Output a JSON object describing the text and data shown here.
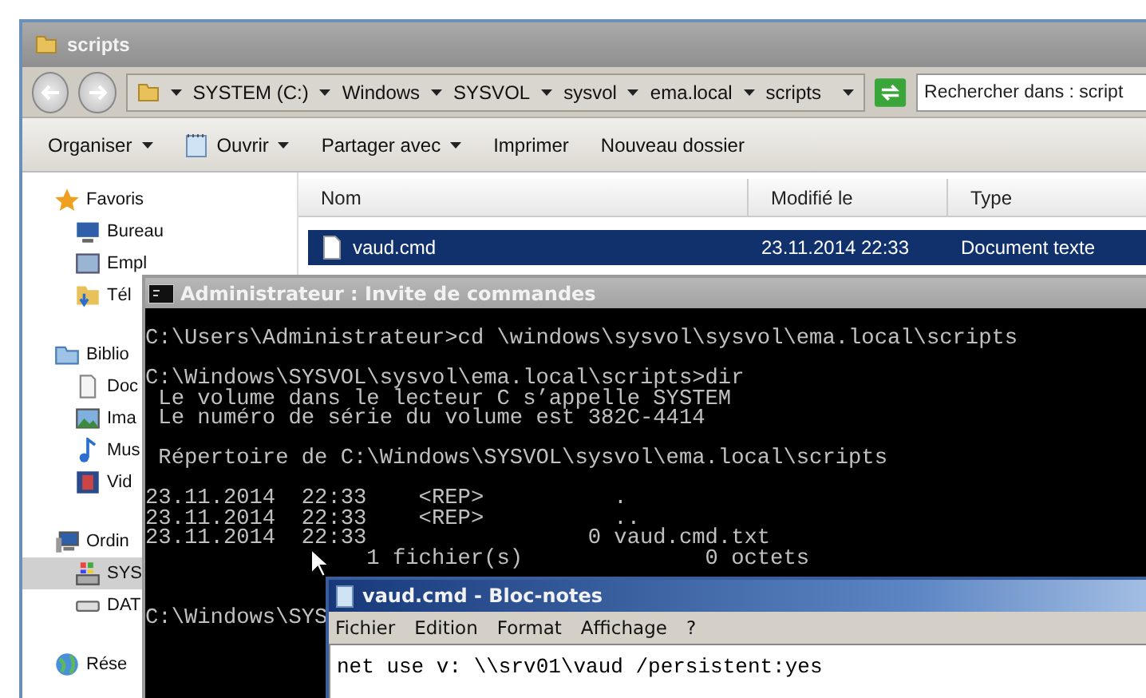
{
  "explorer": {
    "title": "scripts",
    "breadcrumb": [
      "SYSTEM (C:)",
      "Windows",
      "SYSVOL",
      "sysvol",
      "ema.local",
      "scripts"
    ],
    "search": {
      "placeholder": "Rechercher dans : script"
    },
    "toolbar": [
      {
        "label": "Organiser",
        "kind": "menu"
      },
      {
        "label": "Ouvrir",
        "kind": "app-menu"
      },
      {
        "label": "Partager avec",
        "kind": "menu"
      },
      {
        "label": "Imprimer",
        "kind": "plain"
      },
      {
        "label": "Nouveau dossier",
        "kind": "plain"
      }
    ],
    "sidebar": [
      {
        "label": "Favoris",
        "kind": "star",
        "children": [
          {
            "label": "Bureau",
            "kind": "desktop",
            "selected": false
          },
          {
            "label": "Empl",
            "kind": "recent",
            "selected": false
          },
          {
            "label": "Tél",
            "kind": "download",
            "selected": false
          }
        ]
      },
      {
        "label": "Biblio",
        "kind": "library",
        "children": [
          {
            "label": "Doc",
            "kind": "document",
            "selected": false
          },
          {
            "label": "Ima",
            "kind": "image",
            "selected": false
          },
          {
            "label": "Mus",
            "kind": "music",
            "selected": false
          },
          {
            "label": "Vid",
            "kind": "video",
            "selected": false
          }
        ]
      },
      {
        "label": "Ordin",
        "kind": "computer",
        "children": [
          {
            "label": "SYS",
            "kind": "drive",
            "selected": true
          },
          {
            "label": "DAT",
            "kind": "disk",
            "selected": false
          }
        ]
      },
      {
        "label": "Rése",
        "kind": "network"
      }
    ],
    "columns": [
      "Nom",
      "Modifié le",
      "Type"
    ],
    "rows": [
      {
        "cells": [
          "vaud.cmd",
          "23.11.2014 22:33",
          "Document texte"
        ],
        "selected": true
      }
    ]
  },
  "console": {
    "title": "Administrateur : Invite de commandes",
    "blocks": [
      [
        "C:\\Users\\Administrateur>cd \\windows\\sysvol\\sysvol\\ema.local\\scripts"
      ],
      [
        "C:\\Windows\\SYSVOL\\sysvol\\ema.local\\scripts>dir",
        " Le volume dans le lecteur C s’appelle SYSTEM",
        " Le numéro de série du volume est 382C-4414"
      ],
      [
        " Répertoire de C:\\Windows\\SYSVOL\\sysvol\\ema.local\\scripts"
      ],
      [
        "23.11.2014  22:33    <REP>          .",
        "23.11.2014  22:33    <REP>          ..",
        "23.11.2014  22:33                 0 vaud.cmd.txt",
        "                 1 fichier(s)              0 octets"
      ]
    ],
    "prompt": "C:\\Windows\\SYS"
  },
  "notepad": {
    "title": "vaud.cmd - Bloc-notes",
    "menu": [
      "Fichier",
      "Edition",
      "Format",
      "Affichage",
      "?"
    ],
    "text": "net use v: \\\\srv01\\vaud /persistent:yes"
  }
}
